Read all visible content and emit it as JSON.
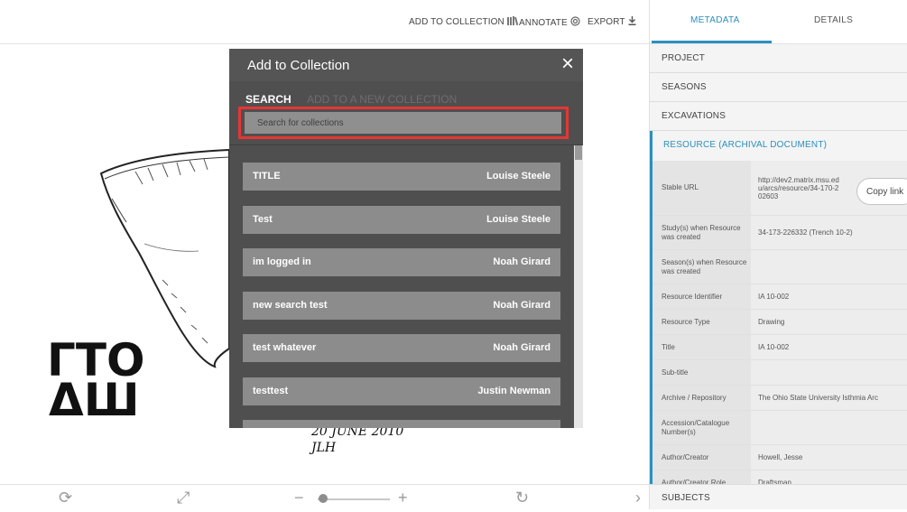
{
  "toolbar": {
    "add_to_collection": "ADD TO COLLECTION",
    "annotate": "ANNOTATE",
    "export": "EXPORT"
  },
  "drawing": {
    "date_text": "20 JUNE 2010",
    "initials_text": "JLH",
    "label_line1": "ΓΤΟ",
    "label_line2": "ΔШ"
  },
  "modal": {
    "title": "Add to Collection",
    "close": "×",
    "tab_search": "SEARCH",
    "tab_new": "ADD TO A NEW COLLECTION",
    "search_placeholder": "Search for collections",
    "collections": [
      {
        "name": "TITLE",
        "owner": "Louise Steele"
      },
      {
        "name": "Test",
        "owner": "Louise Steele"
      },
      {
        "name": "im logged in",
        "owner": "Noah Girard"
      },
      {
        "name": "new search test",
        "owner": "Noah Girard"
      },
      {
        "name": "test whatever",
        "owner": "Noah Girard"
      },
      {
        "name": "testtest",
        "owner": "Justin Newman"
      },
      {
        "name": "",
        "owner": ""
      }
    ]
  },
  "panel": {
    "tab_metadata": "METADATA",
    "tab_details": "DETAILS",
    "sections": [
      "PROJECT",
      "SEASONS",
      "EXCAVATIONS"
    ],
    "resource_title": "RESOURCE (ARCHIVAL DOCUMENT)",
    "copy_button": "Copy link",
    "fields": [
      {
        "key": "Stable URL",
        "value": "http://dev2.matrix.msu.edu/arcs/resource/34-170-202603"
      },
      {
        "key": "Study(s) when Resource was created",
        "value": "34-173-226332 (Trench 10-2)"
      },
      {
        "key": "Season(s) when Resource was created",
        "value": ""
      },
      {
        "key": "Resource Identifier",
        "value": "IA 10-002"
      },
      {
        "key": "Resource Type",
        "value": "Drawing"
      },
      {
        "key": "Title",
        "value": "IA 10-002"
      },
      {
        "key": "Sub-title",
        "value": ""
      },
      {
        "key": "Archive / Repository",
        "value": "The Ohio State University Isthmia Arc"
      },
      {
        "key": "Accession/Catalogue Number(s)",
        "value": ""
      },
      {
        "key": "Author/Creator",
        "value": "Howell, Jesse"
      },
      {
        "key": "Author/Creator Role",
        "value": "Draftsman"
      }
    ],
    "subjects": "SUBJECTS"
  }
}
